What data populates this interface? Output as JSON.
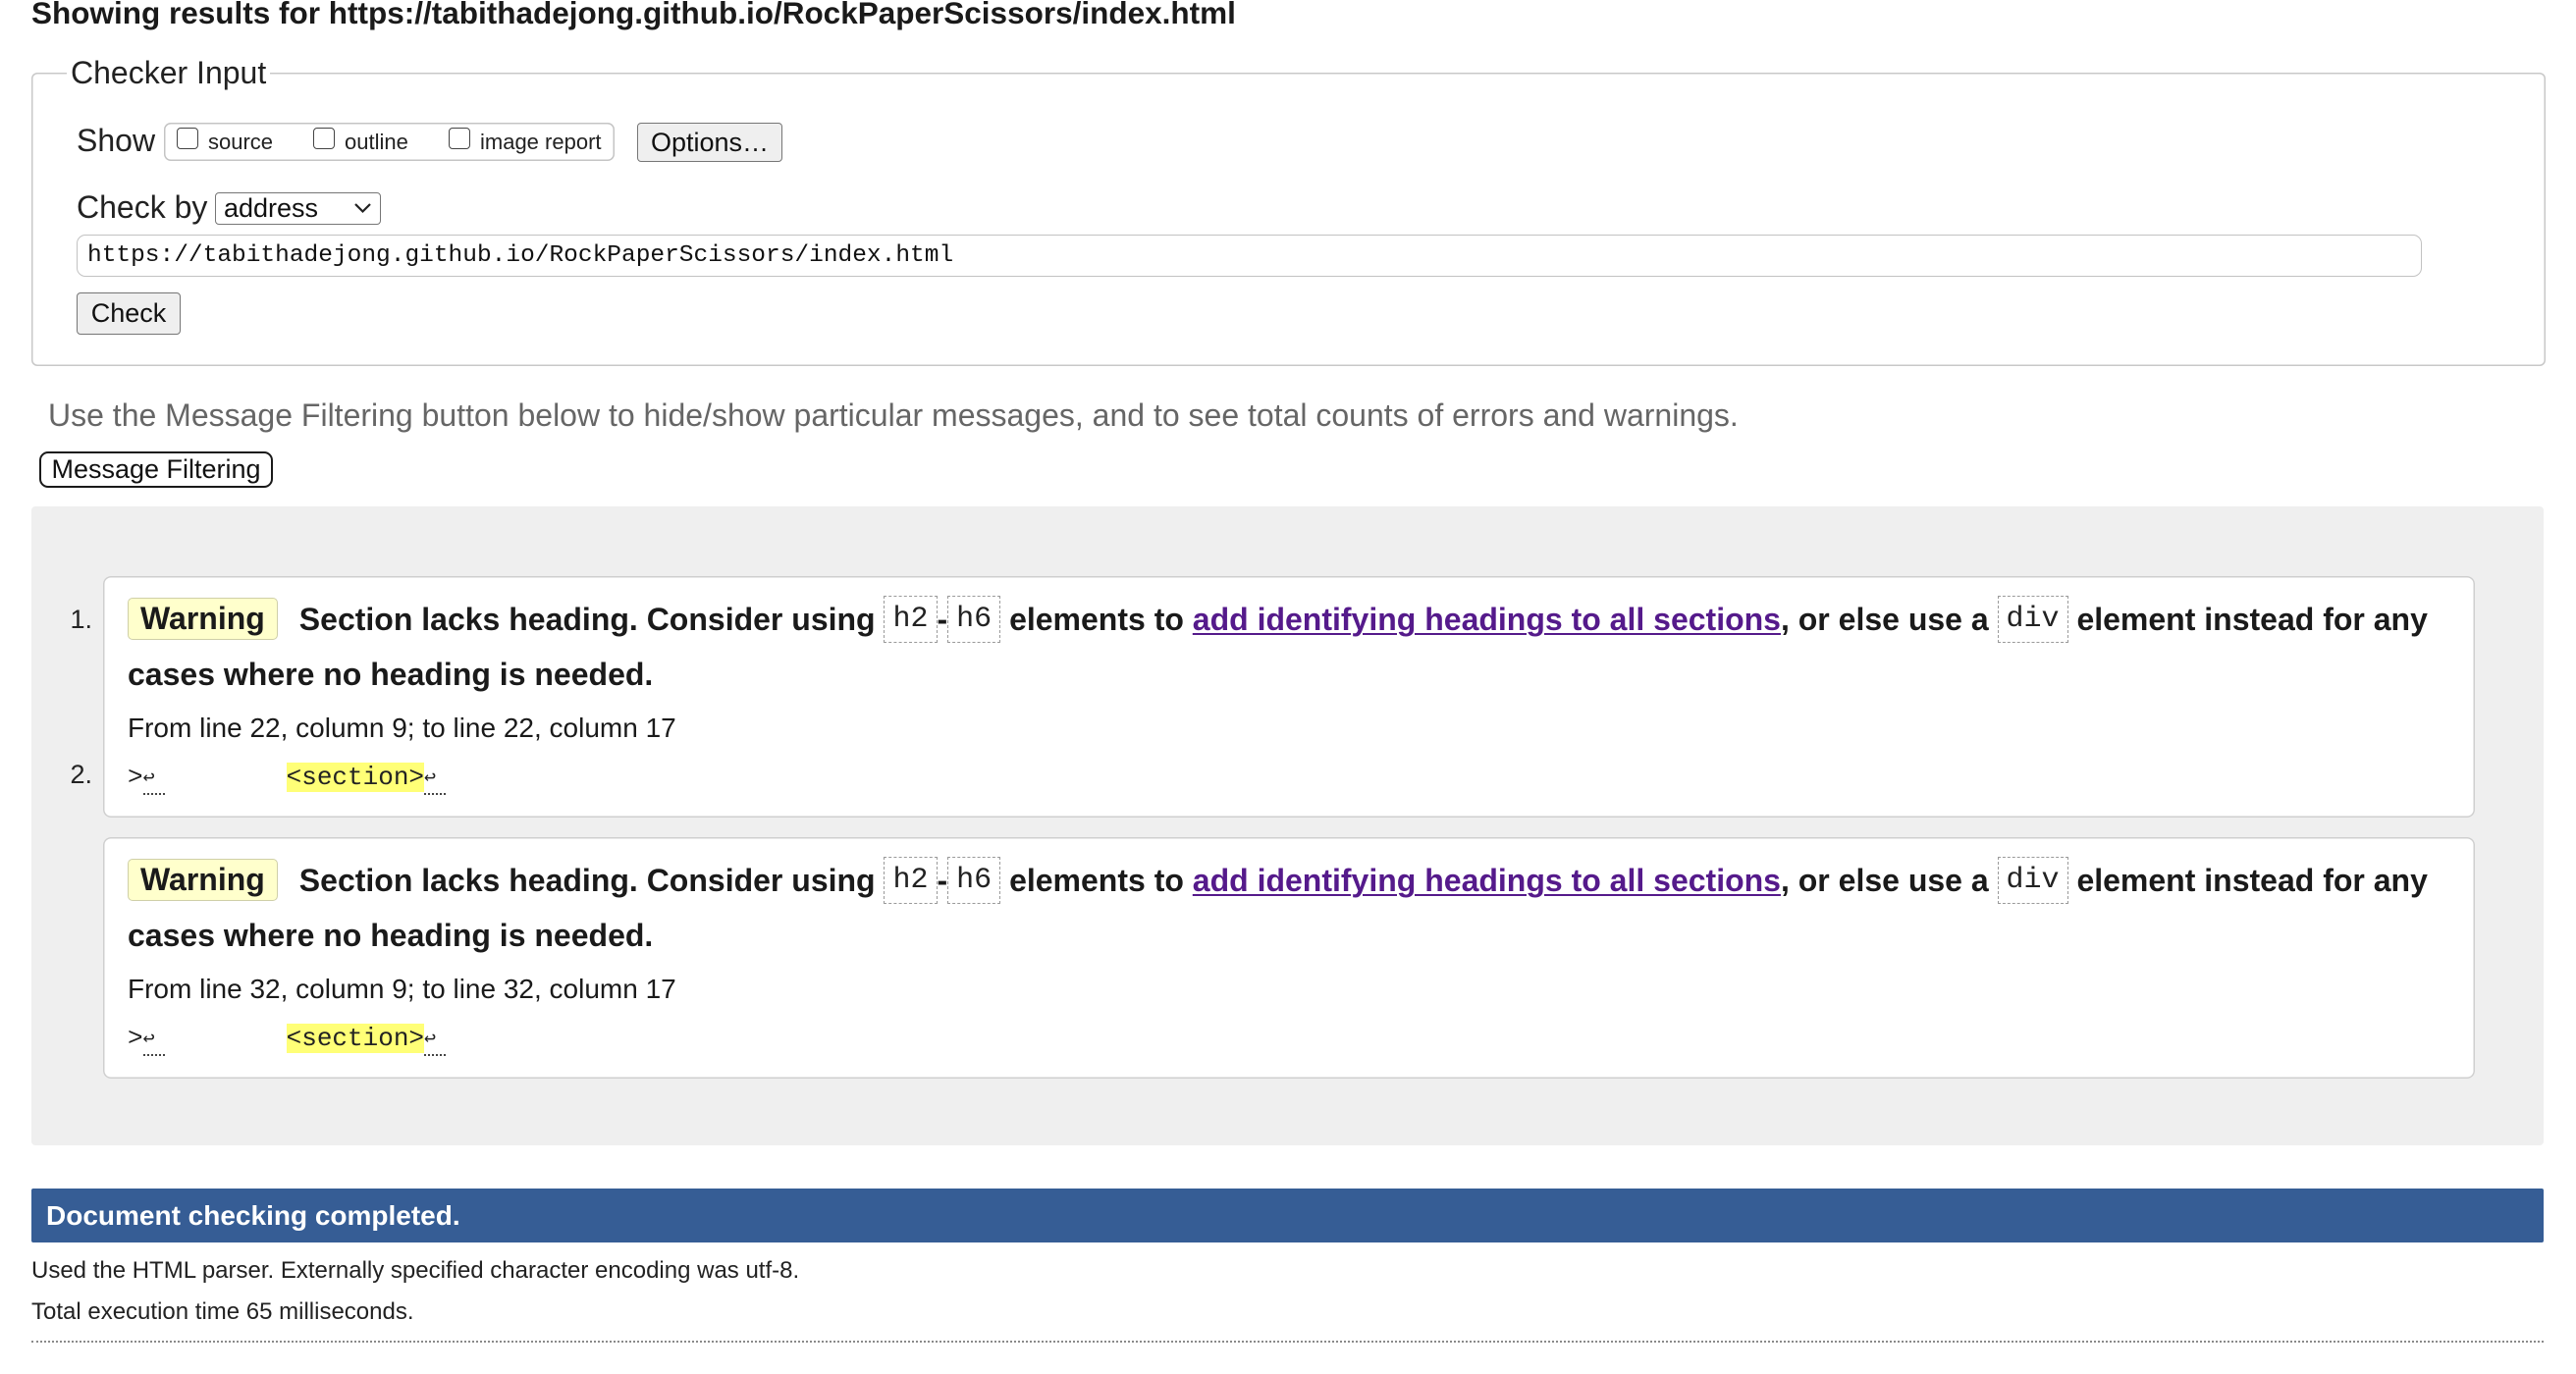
{
  "colors": {
    "status_bar": "#365d95",
    "warning_badge": "#ffffcc",
    "highlight": "#ffff77",
    "link": "#551a8b",
    "panel": "#efefef"
  },
  "header": {
    "title": "Showing results for https://tabithadejong.github.io/RockPaperScissors/index.html"
  },
  "checker": {
    "legend": "Checker Input",
    "show_label": "Show",
    "show_options": [
      {
        "label": "source",
        "checked": false
      },
      {
        "label": "outline",
        "checked": false
      },
      {
        "label": "image report",
        "checked": false
      }
    ],
    "options_button": "Options…",
    "check_by_label": "Check by",
    "check_by_selected": "address",
    "check_by_icon": "chevron-down-icon",
    "url_value": "https://tabithadejong.github.io/RockPaperScissors/index.html",
    "check_button": "Check"
  },
  "filtering": {
    "hint": "Use the Message Filtering button below to hide/show particular messages, and to see total counts of errors and warnings.",
    "button": "Message Filtering"
  },
  "messages": [
    {
      "number": "1.",
      "type": "Warning",
      "text_before": "Section lacks heading. Consider using ",
      "code_from": "h2",
      "range_dash": "-",
      "code_to": "h6",
      "text_mid": " elements to ",
      "link_text": "add identifying headings to all sections",
      "text_after_link": ", or else use a ",
      "code_alt": "div",
      "text_end": " element instead for any cases where no heading is needed.",
      "location": "From line 22, column 9; to line 22, column 17",
      "extract": {
        "before": ">",
        "newline": "↩",
        "highlight": "<section>",
        "after": "↩"
      }
    },
    {
      "number": "2.",
      "type": "Warning",
      "text_before": "Section lacks heading. Consider using ",
      "code_from": "h2",
      "range_dash": "-",
      "code_to": "h6",
      "text_mid": " elements to ",
      "link_text": "add identifying headings to all sections",
      "text_after_link": ", or else use a ",
      "code_alt": "div",
      "text_end": " element instead for any cases where no heading is needed.",
      "location": "From line 32, column 9; to line 32, column 17",
      "extract": {
        "before": ">",
        "newline": "↩",
        "highlight": "<section>",
        "after": "↩"
      }
    }
  ],
  "summary": {
    "status": "Document checking completed.",
    "parser_note": "Used the HTML parser. Externally specified character encoding was utf-8.",
    "execution_time": "Total execution time 65 milliseconds."
  }
}
